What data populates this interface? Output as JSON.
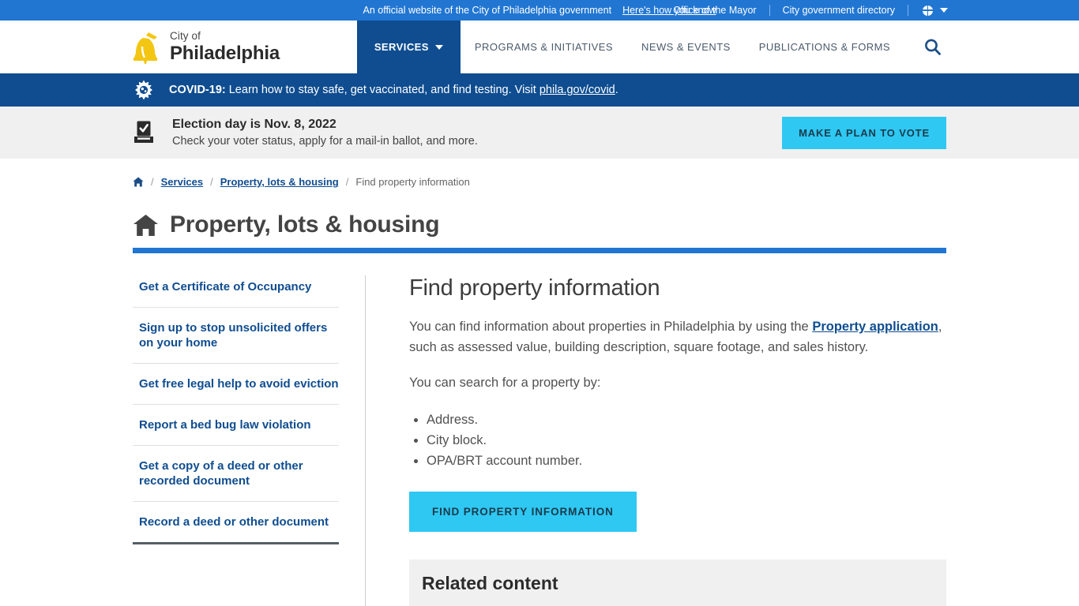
{
  "official_bar": {
    "notice": "An official website of the City of Philadelphia government",
    "how_link": "Here's how you know",
    "mayor_link": "Office of the Mayor",
    "directory_link": "City government directory",
    "language_icon": "globe-icon"
  },
  "masthead": {
    "brand_line1": "City of",
    "brand_line2": "Philadelphia",
    "logo_icon": "liberty-bell-icon",
    "nav": [
      {
        "label": "SERVICES",
        "active": true
      },
      {
        "label": "PROGRAMS & INITIATIVES",
        "active": false
      },
      {
        "label": "NEWS & EVENTS",
        "active": false
      },
      {
        "label": "PUBLICATIONS & FORMS",
        "active": false
      }
    ],
    "search_icon": "search-icon"
  },
  "covid_alert": {
    "icon": "virus-icon",
    "label": "COVID-19:",
    "text": " Learn how to stay safe, get vaccinated, and find testing. Visit ",
    "link": "phila.gov/covid",
    "period": "."
  },
  "election_alert": {
    "icon": "ballot-box-icon",
    "title": "Election day is Nov. 8, 2022",
    "subtitle": "Check your voter status, apply for a mail-in ballot, and more.",
    "button": "MAKE A PLAN TO VOTE"
  },
  "breadcrumb": {
    "home_icon": "home-icon",
    "separator": "/",
    "items": [
      {
        "label": "Services",
        "current": false
      },
      {
        "label": "Property, lots & housing",
        "current": false
      },
      {
        "label": "Find property information",
        "current": true
      }
    ]
  },
  "page_header": {
    "icon": "house-icon",
    "title": "Property, lots & housing",
    "rule_color": "#2176d2"
  },
  "sidebar": {
    "items": [
      {
        "label": "Get a Certificate of Occupancy"
      },
      {
        "label": "Sign up to stop unsolicited offers on your home"
      },
      {
        "label": "Get free legal help to avoid eviction"
      },
      {
        "label": "Report a bed bug law violation"
      },
      {
        "label": "Get a copy of a deed or other recorded document"
      },
      {
        "label": "Record a deed or other document"
      }
    ]
  },
  "main": {
    "heading": "Find property information",
    "intro_part1": "You can find information about properties in Philadelphia by using the ",
    "intro_link": "Property application",
    "intro_part2": ", such as assessed value, building description, square footage, and sales history.",
    "search_lead": "You can search for a property by:",
    "search_options": [
      "Address.",
      "City block.",
      "OPA/BRT account number."
    ],
    "cta_button": "FIND PROPERTY INFORMATION",
    "related_heading": "Related content"
  },
  "colors": {
    "bright_blue": "#2176d2",
    "dark_blue": "#0f4d90",
    "cyan_button": "#2ec8f3",
    "logo_yellow": "#f3c613",
    "gray_bg": "#f0f0f0"
  }
}
